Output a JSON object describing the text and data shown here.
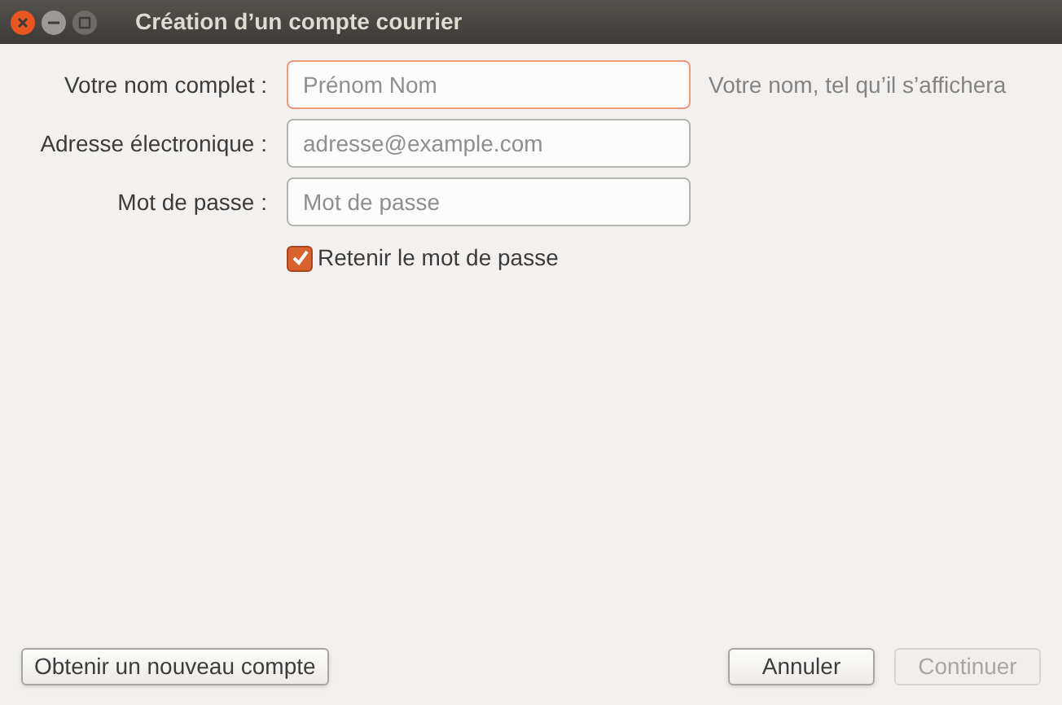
{
  "window": {
    "title": "Création d’un compte courrier"
  },
  "fields": [
    {
      "label": "Votre nom complet :",
      "placeholder": "Prénom Nom",
      "focused": true,
      "hint": "Votre nom, tel qu’il s’affichera"
    },
    {
      "label": "Adresse électronique :",
      "placeholder": "adresse@example.com",
      "focused": false
    },
    {
      "label": "Mot de passe :",
      "placeholder": "Mot de passe",
      "focused": false
    }
  ],
  "remember": {
    "label": "Retenir le mot de passe",
    "checked": true
  },
  "left_buttons": [
    {
      "label": "Obtenir un nouveau compte",
      "disabled": false
    }
  ],
  "right_buttons": [
    {
      "label": "Annuler",
      "disabled": false
    },
    {
      "label": "Continuer",
      "disabled": true
    }
  ]
}
